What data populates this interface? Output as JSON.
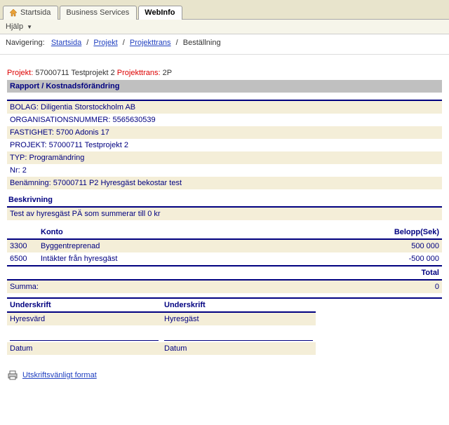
{
  "tabs": {
    "startsida": "Startsida",
    "business_services": "Business Services",
    "webinfo": "WebInfo"
  },
  "menu": {
    "help": "Hjälp"
  },
  "breadcrumb": {
    "label": "Navigering:",
    "startsida": "Startsida",
    "projekt": "Projekt",
    "projekttrans": "Projekttrans",
    "current": "Beställning"
  },
  "topline": {
    "projekt_label": "Projekt:",
    "projekt_value": "57000711 Testprojekt 2",
    "projekttrans_label": "Projekttrans:",
    "projekttrans_value": "2P"
  },
  "section_header": "Rapport / Kostnadsförändring",
  "info": {
    "bolag": "BOLAG: Diligentia Storstockholm AB",
    "orgnr": "ORGANISATIONSNUMMER: 5565630539",
    "fastighet": "FASTIGHET: 5700 Adonis 17",
    "projekt": "PROJEKT: 57000711 Testprojekt 2",
    "typ": "TYP: Programändring",
    "nr": "Nr: 2",
    "benamning": "Benämning: 57000711 P2 Hyresgäst bekostar test"
  },
  "beskrivning": {
    "header": "Beskrivning",
    "text": "Test av hyresgäst PÄ som summerar till 0 kr"
  },
  "konto": {
    "col_konto": "Konto",
    "col_belopp": "Belopp(Sek)",
    "rows": [
      {
        "kod": "3300",
        "name": "Byggentreprenad",
        "belopp": "500 000"
      },
      {
        "kod": "6500",
        "name": "Intäkter från hyresgäst",
        "belopp": "-500 000"
      }
    ],
    "total_label": "Total",
    "summa_label": "Summa:",
    "summa_value": "0"
  },
  "sign": {
    "header": "Underskrift",
    "hyresvard": "Hyresvärd",
    "hyresgast": "Hyresgäst",
    "datum": "Datum"
  },
  "print_link": "Utskriftsvänligt format"
}
